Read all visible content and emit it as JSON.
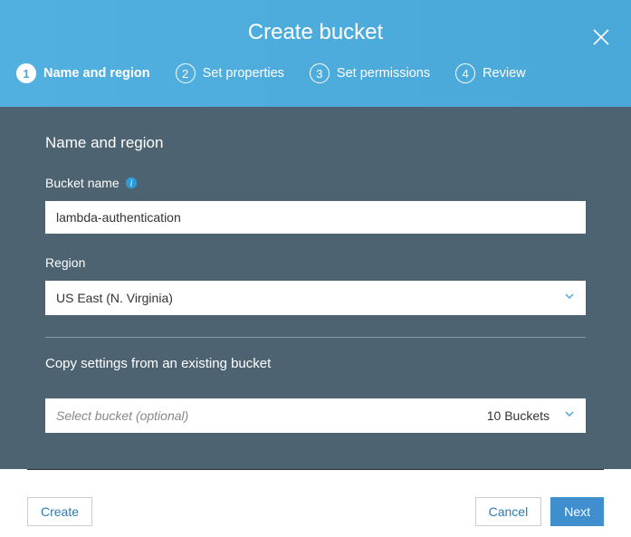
{
  "header": {
    "title": "Create bucket",
    "steps": [
      {
        "num": "1",
        "label": "Name and region",
        "active": true
      },
      {
        "num": "2",
        "label": "Set properties",
        "active": false
      },
      {
        "num": "3",
        "label": "Set permissions",
        "active": false
      },
      {
        "num": "4",
        "label": "Review",
        "active": false
      }
    ]
  },
  "body": {
    "section_title": "Name and region",
    "bucket_name": {
      "label": "Bucket name",
      "value": "lambda-authentication"
    },
    "region": {
      "label": "Region",
      "value": "US East (N. Virginia)"
    },
    "copy": {
      "title": "Copy settings from an existing bucket",
      "placeholder": "Select bucket (optional)",
      "count": "10 Buckets"
    }
  },
  "footer": {
    "create": "Create",
    "cancel": "Cancel",
    "next": "Next"
  }
}
